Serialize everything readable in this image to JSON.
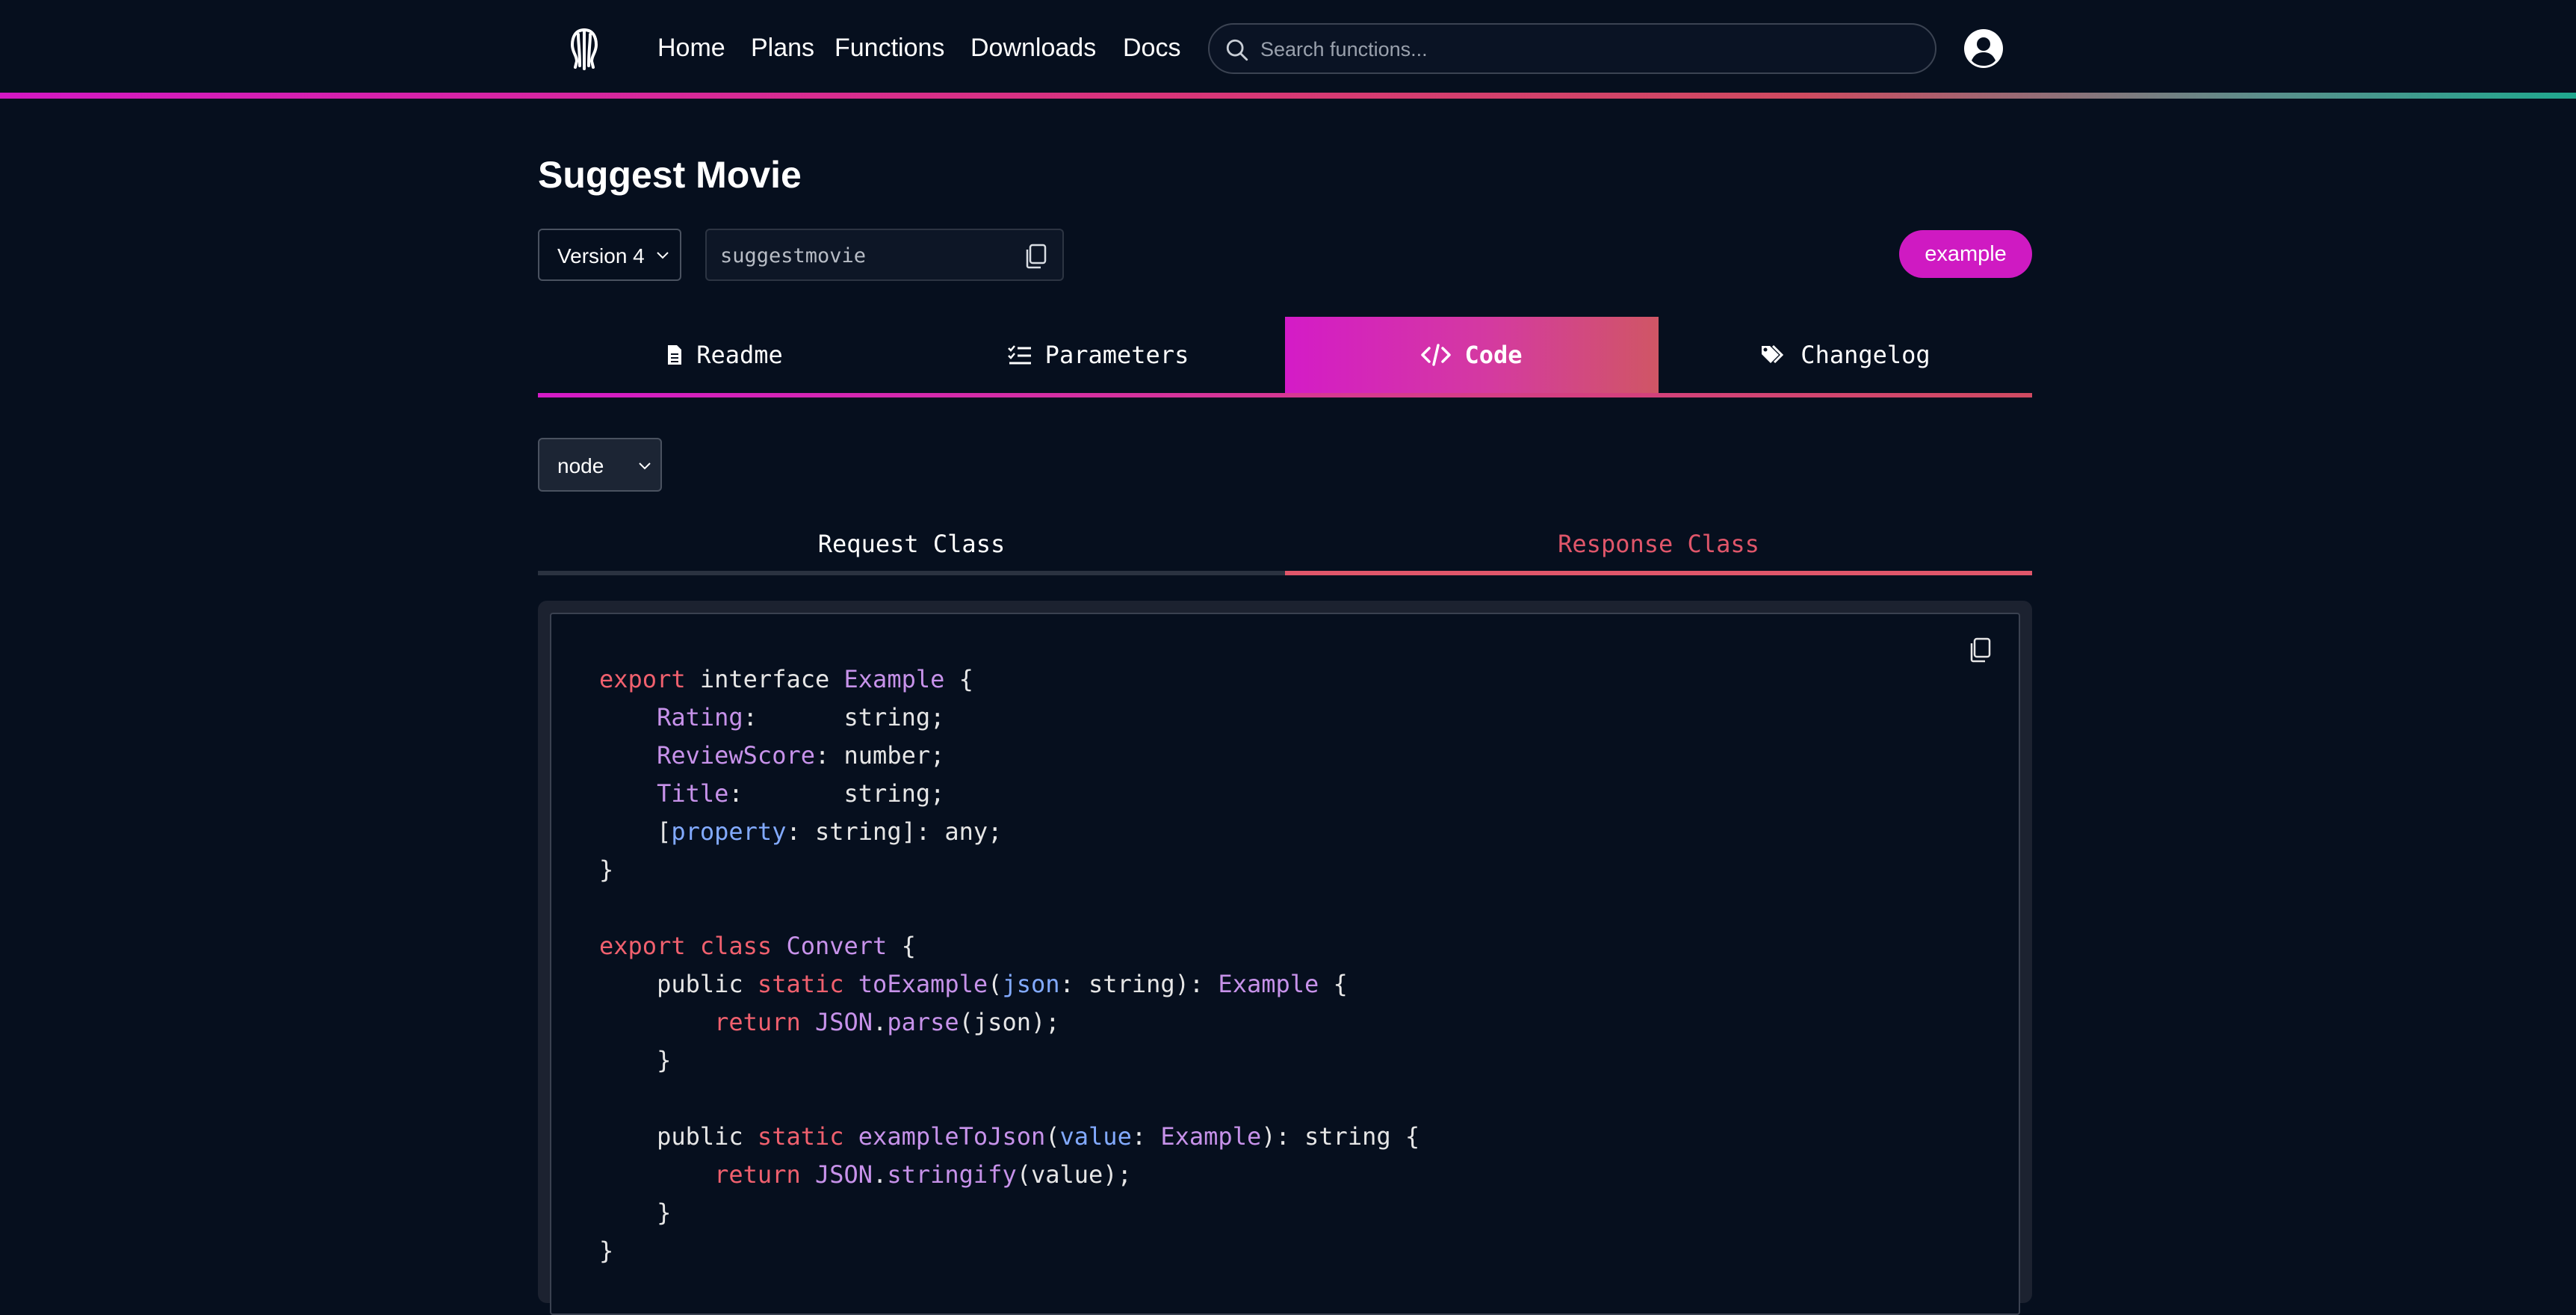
{
  "nav": {
    "links": [
      "Home",
      "Plans",
      "Functions",
      "Downloads",
      "Docs"
    ],
    "search_placeholder": "Search functions..."
  },
  "function": {
    "title": "Suggest Movie",
    "version_label": "Version 4",
    "slug": "suggestmovie",
    "badge": "example"
  },
  "tabs": [
    {
      "label": "Readme",
      "icon": "document-icon"
    },
    {
      "label": "Parameters",
      "icon": "checklist-icon"
    },
    {
      "label": "Code",
      "icon": "code-icon",
      "active": true
    },
    {
      "label": "Changelog",
      "icon": "tags-icon"
    }
  ],
  "code": {
    "language": "node",
    "subtabs": [
      "Request Class",
      "Response Class"
    ],
    "active_subtab": "Response Class",
    "lines": [
      "export interface Example {",
      "    Rating:      string;",
      "    ReviewScore: number;",
      "    Title:       string;",
      "    [property: string]: any;",
      "}",
      "",
      "export class Convert {",
      "    public static toExample(json: string): Example {",
      "        return JSON.parse(json);",
      "    }",
      "",
      "    public static exampleToJson(value: Example): string {",
      "        return JSON.stringify(value);",
      "    }",
      "}"
    ]
  },
  "colors": {
    "background": "#060f1e",
    "accent_magenta": "#d41bc7",
    "accent_coral": "#e0566a",
    "keyword": "#f0606e",
    "type": "#c792ea",
    "param": "#82aaff"
  }
}
